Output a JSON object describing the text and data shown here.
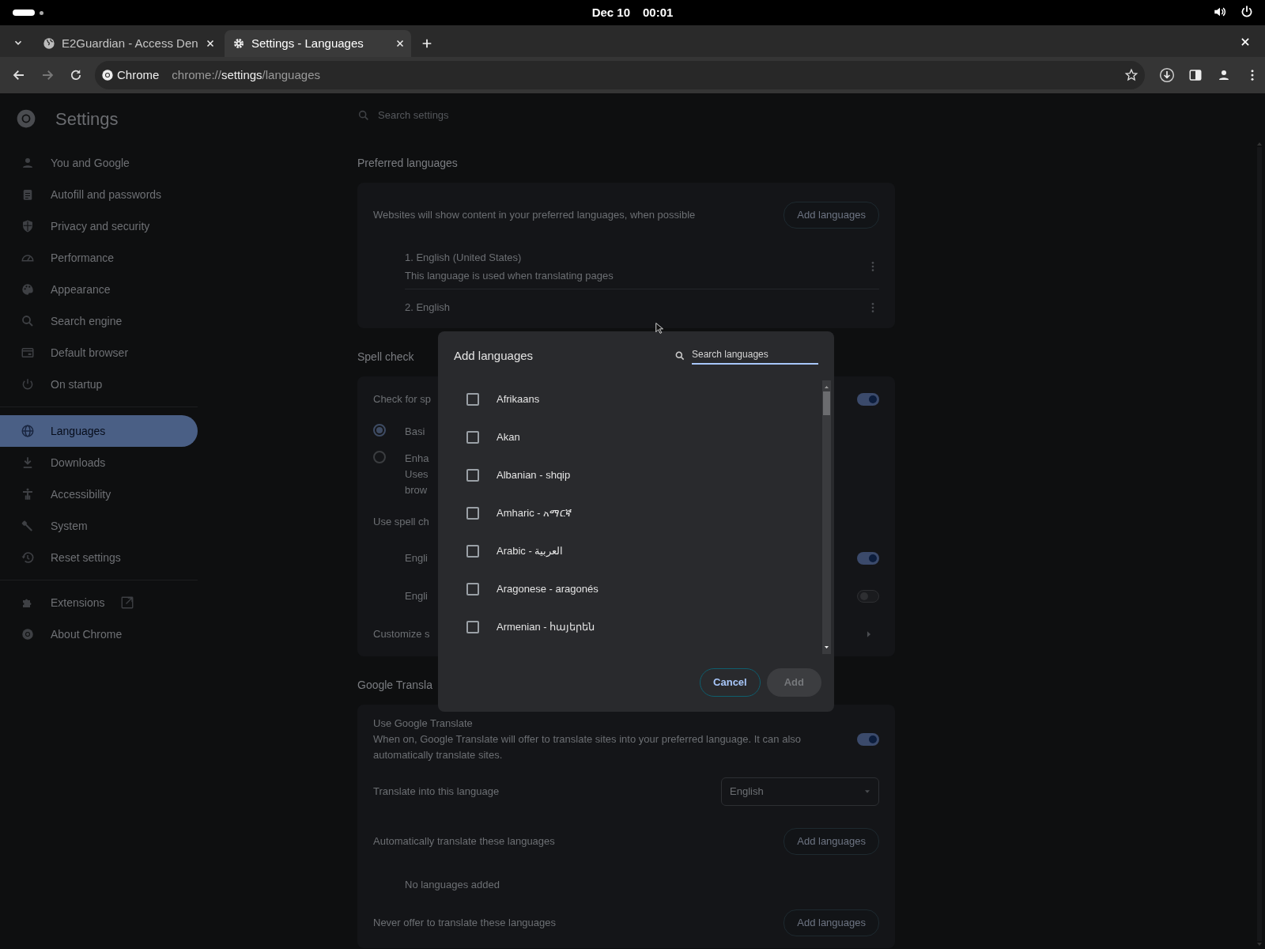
{
  "system_bar": {
    "date": "Dec 10",
    "time": "00:01"
  },
  "tabs": [
    {
      "title": "E2Guardian - Access Den",
      "selected": false
    },
    {
      "title": "Settings - Languages",
      "selected": true
    }
  ],
  "address_bar": {
    "site_label": "Chrome",
    "url_scheme": "chrome://",
    "url_host": "settings",
    "url_path": "/languages"
  },
  "settings_header": {
    "title": "Settings",
    "search_placeholder": "Search settings"
  },
  "sidebar": {
    "items": [
      {
        "label": "You and Google",
        "selected": false
      },
      {
        "label": "Autofill and passwords",
        "selected": false
      },
      {
        "label": "Privacy and security",
        "selected": false
      },
      {
        "label": "Performance",
        "selected": false
      },
      {
        "label": "Appearance",
        "selected": false
      },
      {
        "label": "Search engine",
        "selected": false
      },
      {
        "label": "Default browser",
        "selected": false
      },
      {
        "label": "On startup",
        "selected": false
      }
    ],
    "items_2": [
      {
        "label": "Languages",
        "selected": true
      },
      {
        "label": "Downloads",
        "selected": false
      },
      {
        "label": "Accessibility",
        "selected": false
      },
      {
        "label": "System",
        "selected": false
      },
      {
        "label": "Reset settings",
        "selected": false
      }
    ],
    "items_3": [
      {
        "label": "Extensions",
        "selected": false,
        "external": true
      },
      {
        "label": "About Chrome",
        "selected": false,
        "external": false
      }
    ]
  },
  "preferred_languages": {
    "heading": "Preferred languages",
    "description": "Websites will show content in your preferred languages, when possible",
    "add_button": "Add languages",
    "languages": [
      {
        "name": "1. English (United States)",
        "note": "This language is used when translating pages"
      },
      {
        "name": "2. English"
      }
    ]
  },
  "spell_check": {
    "heading": "Spell check",
    "check_label": "Check for sp",
    "check_on": true,
    "options": [
      {
        "label": "Basi",
        "selected": true
      },
      {
        "label": "Enha",
        "lines": [
          "Uses",
          "brow"
        ],
        "selected": false
      }
    ],
    "use_label": "Use spell ch",
    "dictionaries": [
      {
        "label": "Engli",
        "on": true
      },
      {
        "label": "Engli",
        "on": false
      }
    ],
    "customize_label": "Customize s"
  },
  "google_translate": {
    "heading": "Google Transla",
    "title": "Use Google Translate",
    "description": "When on, Google Translate will offer to translate sites into your preferred language. It can also automatically translate sites.",
    "on": true,
    "target_label": "Translate into this language",
    "target_value": "English",
    "auto_label": "Automatically translate these languages",
    "auto_button": "Add languages",
    "auto_empty": "No languages added",
    "never_label": "Never offer to translate these languages",
    "never_button": "Add languages"
  },
  "dialog": {
    "title": "Add languages",
    "search_placeholder": "Search languages",
    "languages": [
      {
        "name": "Afrikaans",
        "checked": false
      },
      {
        "name": "Akan",
        "checked": false
      },
      {
        "name": "Albanian - shqip",
        "checked": false
      },
      {
        "name": "Amharic - አማርኛ",
        "checked": false
      },
      {
        "name": "Arabic - العربية",
        "checked": false
      },
      {
        "name": "Aragonese - aragonés",
        "checked": false
      },
      {
        "name": "Armenian - հայերեն",
        "checked": false
      }
    ],
    "cancel_button": "Cancel",
    "add_button": "Add",
    "add_disabled": true
  }
}
